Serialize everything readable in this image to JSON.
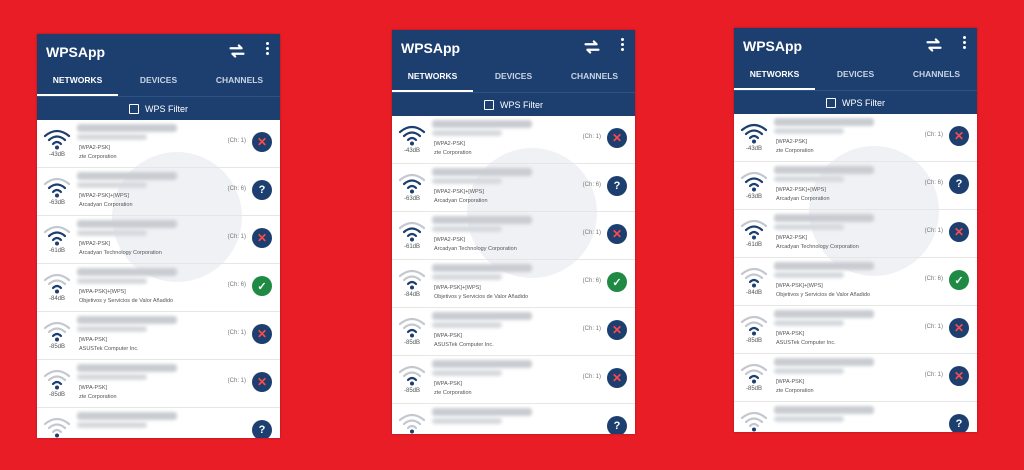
{
  "app": {
    "title": "WPSApp"
  },
  "tabs": [
    "NETWORKS",
    "DEVICES",
    "CHANNELS"
  ],
  "filter": {
    "label": "WPS Filter"
  },
  "networks": [
    {
      "dbm": "-43dB",
      "security": "[WPA2-PSK]",
      "vendor": "zte Corporation",
      "channel": "(Ch: 1)",
      "status": "x",
      "strength": 4
    },
    {
      "dbm": "-63dB",
      "security": "[WPA2-PSK]+[WPS]",
      "vendor": "Arcadyan Corporation",
      "channel": "(Ch: 6)",
      "status": "q",
      "strength": 3
    },
    {
      "dbm": "-61dB",
      "security": "[WPA2-PSK]",
      "vendor": "Arcadyan Technology Corporation",
      "channel": "(Ch: 1)",
      "status": "x",
      "strength": 3
    },
    {
      "dbm": "-84dB",
      "security": "[WPA-PSK]+[WPS]",
      "vendor": "Objetivos y Servicios de Valor Añadido",
      "channel": "(Ch: 6)",
      "status": "ok",
      "strength": 2
    },
    {
      "dbm": "-85dB",
      "security": "[WPA-PSK]",
      "vendor": "ASUSTek Computer Inc.",
      "channel": "(Ch: 1)",
      "status": "x",
      "strength": 2
    },
    {
      "dbm": "-85dB",
      "security": "[WPA-PSK]",
      "vendor": "zte Corporation",
      "channel": "(Ch: 1)",
      "status": "x",
      "strength": 2
    },
    {
      "dbm": "",
      "security": "",
      "vendor": "",
      "channel": "",
      "status": "q",
      "strength": 1
    }
  ],
  "colors": {
    "background": "#e81d25",
    "appbar": "#1c3f70",
    "ok": "#1f8a44",
    "cross": "#ff4a4a"
  },
  "icons": {
    "refresh": "refresh-icon",
    "more": "more-vert-icon",
    "wifi": "wifi-icon"
  }
}
